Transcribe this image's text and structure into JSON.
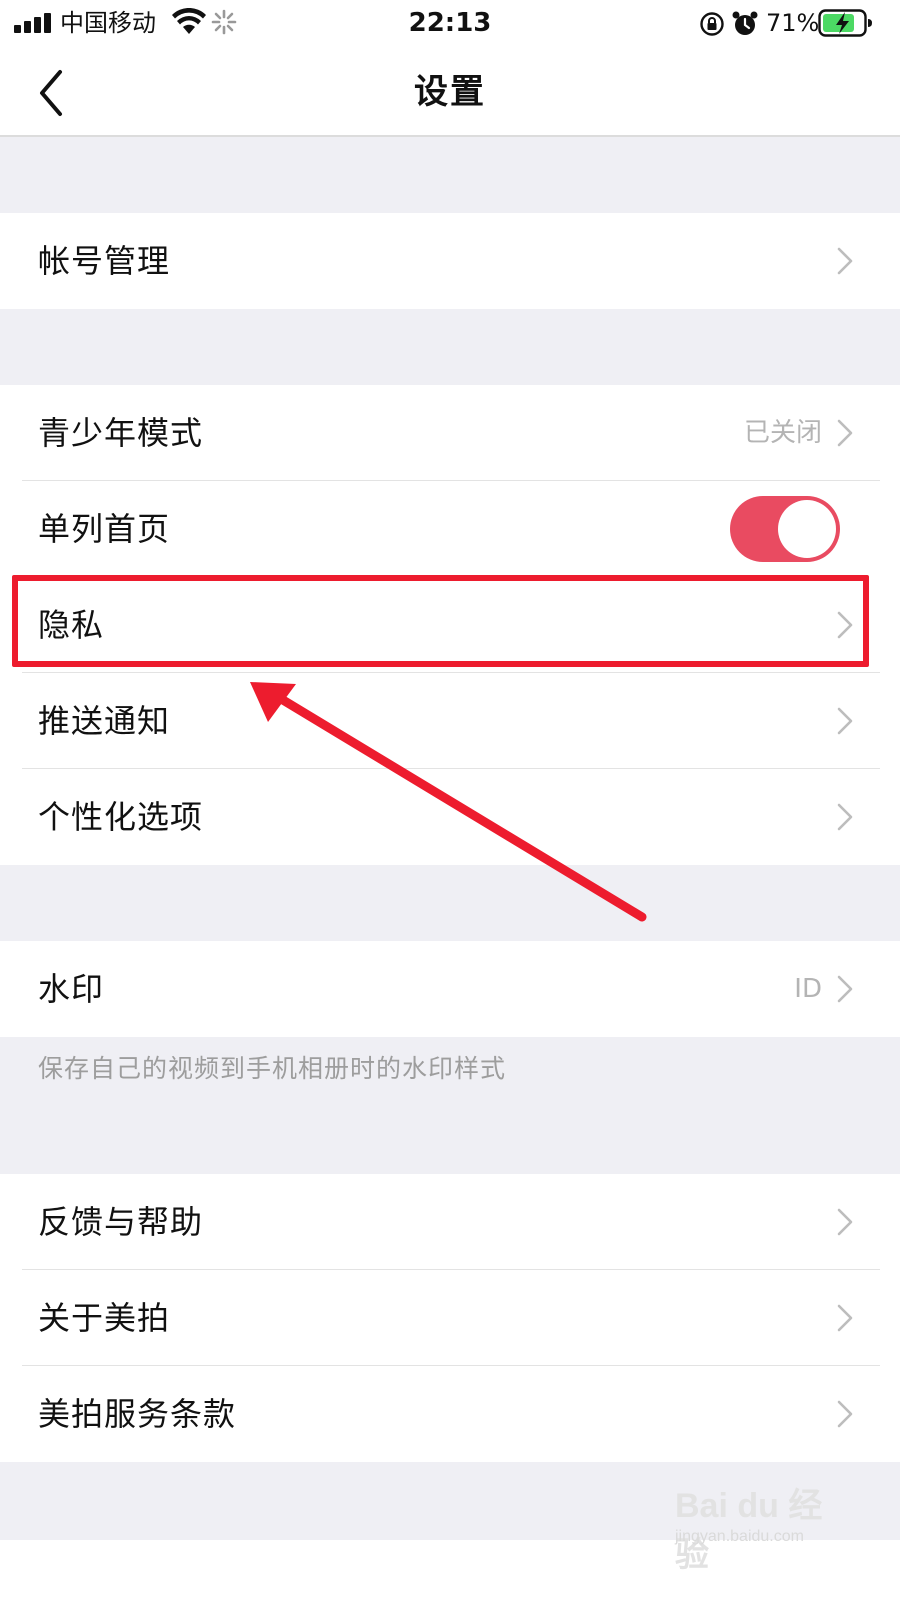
{
  "status_bar": {
    "carrier": "中国移动",
    "time": "22:13",
    "battery_percent": "71%",
    "icons": [
      "signal-icon",
      "wifi-icon",
      "activity-spinner-icon",
      "orientation-lock-icon",
      "alarm-icon",
      "battery-charging-icon"
    ]
  },
  "nav": {
    "title": "设置",
    "back_icon": "chevron-left-icon"
  },
  "sections": {
    "account": {
      "label": "帐号管理"
    },
    "youth_mode": {
      "label": "青少年模式",
      "value": "已关闭"
    },
    "single_column": {
      "label": "单列首页",
      "toggle_on": true
    },
    "privacy": {
      "label": "隐私"
    },
    "push": {
      "label": "推送通知"
    },
    "personalization": {
      "label": "个性化选项"
    },
    "watermark": {
      "label": "水印",
      "value": "ID",
      "hint": "保存自己的视频到手机相册时的水印样式"
    },
    "feedback": {
      "label": "反馈与帮助"
    },
    "about": {
      "label": "关于美拍"
    },
    "terms": {
      "label": "美拍服务条款"
    }
  },
  "annotation": {
    "highlight_color": "#ed1c2e",
    "highlighted_item": "隐私"
  },
  "colors": {
    "toggle_on": "#e94b61",
    "background": "#efeff4",
    "secondary_text": "#b4b4b4"
  },
  "watermark_logo": {
    "text": "Bai du 经验",
    "sub": "jingyan.baidu.com"
  }
}
